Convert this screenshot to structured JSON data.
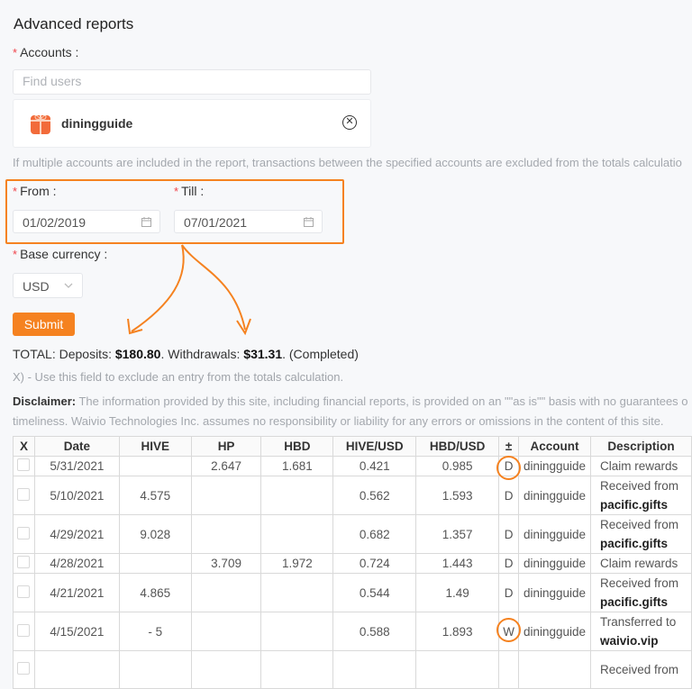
{
  "page_title": "Advanced reports",
  "accounts": {
    "label": "Accounts",
    "search_placeholder": "Find users",
    "selected": [
      {
        "name": "diningguide"
      }
    ],
    "hint": "If multiple accounts are included in the report, transactions between the specified accounts are excluded from the totals calculatio"
  },
  "dates": {
    "from_label": "From",
    "from_value": "01/02/2019",
    "till_label": "Till",
    "till_value": "07/01/2021"
  },
  "currency": {
    "label": "Base currency",
    "value": "USD"
  },
  "submit_label": "Submit",
  "totals": {
    "prefix": "TOTAL: Deposits: ",
    "deposits": "$180.80",
    "mid": ". Withdrawals: ",
    "withdrawals": "$31.31",
    "suffix": ". (Completed)"
  },
  "exclude_note": "X) - Use this field to exclude an entry from the totals calculation.",
  "disclaimer": {
    "label": "Disclaimer:",
    "line1": " The information provided by this site, including financial reports, is provided on an \"\"as is\"\" basis with no guarantees o",
    "line2": "timeliness. Waivio Technologies Inc. assumes no responsibility or liability for any errors or omissions in the content of this site."
  },
  "table": {
    "headers": [
      "X",
      "Date",
      "HIVE",
      "HP",
      "HBD",
      "HIVE/USD",
      "HBD/USD",
      "±",
      "Account",
      "Description"
    ],
    "rows": [
      {
        "date": "5/31/2021",
        "hive": "",
        "hp": "2.647",
        "hbd": "1.681",
        "hive_usd": "0.421",
        "hbd_usd": "0.985",
        "type": "D",
        "account": "diningguide",
        "desc": "Claim rewards",
        "desc_strong": ""
      },
      {
        "date": "5/10/2021",
        "hive": "4.575",
        "hp": "",
        "hbd": "",
        "hive_usd": "0.562",
        "hbd_usd": "1.593",
        "type": "D",
        "account": "diningguide",
        "desc": "Received from",
        "desc_strong": "pacific.gifts"
      },
      {
        "date": "4/29/2021",
        "hive": "9.028",
        "hp": "",
        "hbd": "",
        "hive_usd": "0.682",
        "hbd_usd": "1.357",
        "type": "D",
        "account": "diningguide",
        "desc": "Received from",
        "desc_strong": "pacific.gifts"
      },
      {
        "date": "4/28/2021",
        "hive": "",
        "hp": "3.709",
        "hbd": "1.972",
        "hive_usd": "0.724",
        "hbd_usd": "1.443",
        "type": "D",
        "account": "diningguide",
        "desc": "Claim rewards",
        "desc_strong": ""
      },
      {
        "date": "4/21/2021",
        "hive": "4.865",
        "hp": "",
        "hbd": "",
        "hive_usd": "0.544",
        "hbd_usd": "1.49",
        "type": "D",
        "account": "diningguide",
        "desc": "Received from",
        "desc_strong": "pacific.gifts"
      },
      {
        "date": "4/15/2021",
        "hive": "- 5",
        "hp": "",
        "hbd": "",
        "hive_usd": "0.588",
        "hbd_usd": "1.893",
        "type": "W",
        "account": "diningguide",
        "desc": "Transferred to",
        "desc_strong": "waivio.vip"
      },
      {
        "date": "",
        "hive": "",
        "hp": "",
        "hbd": "",
        "hive_usd": "",
        "hbd_usd": "",
        "type": "",
        "account": "",
        "desc": "Received from",
        "desc_strong": ""
      }
    ]
  },
  "colors": {
    "accent": "#f58220",
    "required": "#f0434b"
  }
}
